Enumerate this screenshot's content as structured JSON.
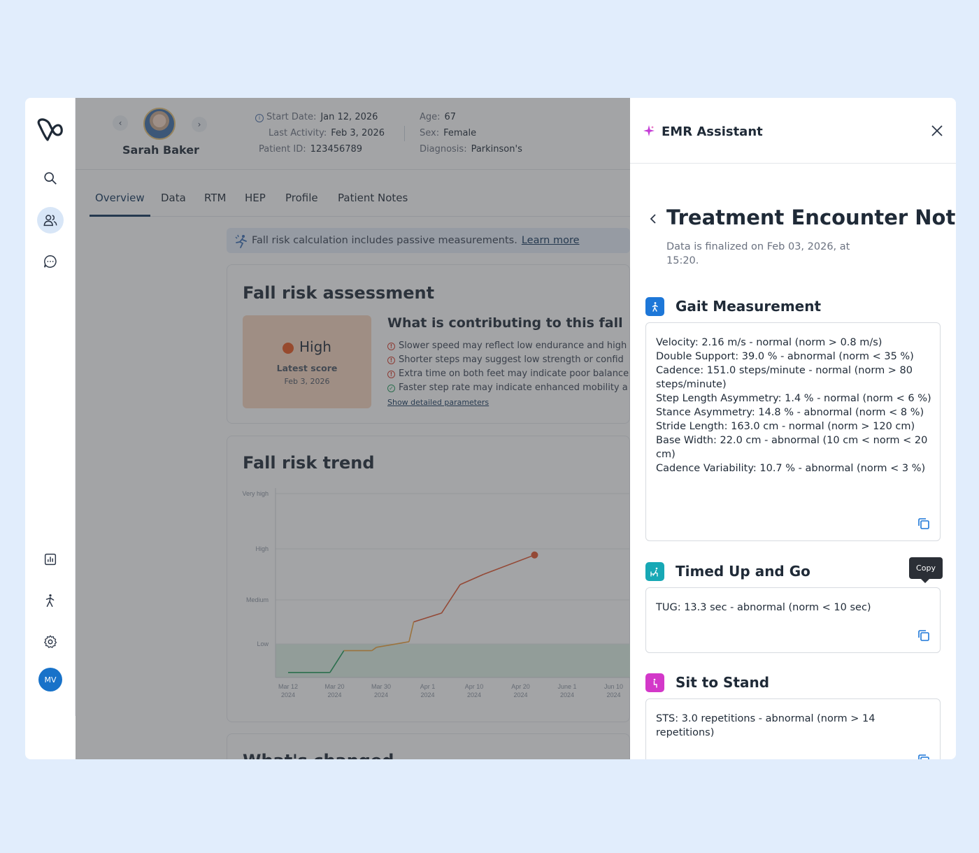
{
  "patient": {
    "name": "Sarah Baker",
    "start_date_label": "Start Date:",
    "start_date": "Jan 12, 2026",
    "last_activity_label": "Last Activity:",
    "last_activity": "Feb 3, 2026",
    "patient_id_label": "Patient ID:",
    "patient_id": "123456789",
    "age_label": "Age:",
    "age": "67",
    "sex_label": "Sex:",
    "sex": "Female",
    "diagnosis_label": "Diagnosis:",
    "diagnosis": "Parkinson's"
  },
  "sidebar": {
    "avatar_initials": "MV"
  },
  "tabs": [
    {
      "label": "Overview"
    },
    {
      "label": "Data"
    },
    {
      "label": "RTM"
    },
    {
      "label": "HEP"
    },
    {
      "label": "Profile"
    },
    {
      "label": "Patient Notes"
    }
  ],
  "banner": {
    "text": "Fall risk calculation includes passive measurements.",
    "link": "Learn more"
  },
  "assessment": {
    "title": "Fall risk assessment",
    "level": "High",
    "score_label": "Latest score",
    "score_date": "Feb 3, 2026",
    "contrib_title": "What is contributing to this fall",
    "items": [
      {
        "text": "Slower speed may reflect low endurance and high"
      },
      {
        "text": "Shorter steps may suggest low strength or confid"
      },
      {
        "text": "Extra time on both feet may indicate poor balance"
      },
      {
        "text": "Faster step rate may indicate enhanced mobility a"
      }
    ],
    "detail_link": "Show detailed parameters"
  },
  "trend": {
    "title": "Fall risk trend",
    "chart_data": {
      "type": "line",
      "y_categories": [
        "Low",
        "Medium",
        "High",
        "Very high"
      ],
      "x_ticks": [
        {
          "label": "Mar 12",
          "year": "2024"
        },
        {
          "label": "Mar 20",
          "year": "2024"
        },
        {
          "label": "Mar 30",
          "year": "2024"
        },
        {
          "label": "Apr 1",
          "year": "2024"
        },
        {
          "label": "Apr 10",
          "year": "2024"
        },
        {
          "label": "Apr 20",
          "year": "2024"
        },
        {
          "label": "June 1",
          "year": "2024"
        },
        {
          "label": "Jun 10",
          "year": "2024"
        }
      ],
      "series": [
        {
          "x": [
            0,
            0.9,
            1.2,
            1.8,
            1.9,
            2.6,
            2.7,
            3.3,
            3.7,
            4.2,
            5.3
          ],
          "y": [
            0.15,
            0.15,
            0.8,
            0.8,
            0.9,
            1.05,
            1.5,
            1.7,
            2.3,
            2.5,
            2.88
          ]
        }
      ],
      "colors": {
        "low": "#1e9b58",
        "mid": "#f0a23a",
        "high": "#e2542c"
      }
    }
  },
  "next_card_title": "What's changed",
  "panel": {
    "title": "EMR Assistant",
    "note_title": "Treatment Encounter Note",
    "note_sub": "Data is finalized on Feb 03, 2026, at 15:20.",
    "tooltip": "Copy",
    "sections": [
      {
        "title": "Gait Measurement",
        "color": "#1d77d8",
        "lines": [
          "Velocity: 2.16 m/s - normal (norm > 0.8 m/s)",
          "Double Support: 39.0 % - abnormal (norm < 35 %)",
          "Cadence: 151.0 steps/minute - normal (norm > 80 steps/minute)",
          "Step Length Asymmetry: 1.4 % - normal (norm < 6 %)",
          "Stance Asymmetry: 14.8 % - abnormal (norm < 8 %)",
          "Stride Length: 163.0 cm - normal (norm > 120 cm)",
          "Base Width: 22.0 cm - abnormal (10 cm < norm < 20 cm)",
          "Cadence Variability: 10.7 % - abnormal (norm < 3 %)"
        ]
      },
      {
        "title": "Timed Up and Go",
        "color": "#17a8b5",
        "lines": [
          "TUG: 13.3 sec - abnormal (norm < 10 sec)"
        ]
      },
      {
        "title": "Sit to Stand",
        "color": "#d338c9",
        "lines": [
          "STS: 3.0 repetitions - abnormal (norm > 14 repetitions)"
        ]
      }
    ]
  }
}
